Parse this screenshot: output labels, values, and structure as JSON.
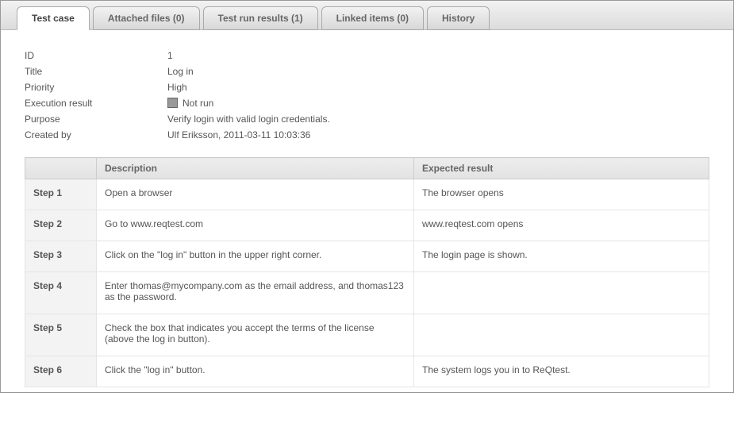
{
  "tabs": [
    {
      "label": "Test case",
      "active": true
    },
    {
      "label": "Attached files (0)",
      "active": false
    },
    {
      "label": "Test run results (1)",
      "active": false
    },
    {
      "label": "Linked items (0)",
      "active": false
    },
    {
      "label": "History",
      "active": false
    }
  ],
  "meta": {
    "id_label": "ID",
    "id_value": "1",
    "title_label": "Title",
    "title_value": "Log in",
    "priority_label": "Priority",
    "priority_value": "High",
    "exec_label": "Execution result",
    "exec_value": "Not run",
    "purpose_label": "Purpose",
    "purpose_value": "Verify login with valid login credentials.",
    "created_label": "Created by",
    "created_value": "Ulf Eriksson, 2011-03-11 10:03:36"
  },
  "table": {
    "headers": {
      "step": "",
      "description": "Description",
      "expected": "Expected result"
    },
    "rows": [
      {
        "step": "Step 1",
        "description": "Open a browser",
        "expected": "The browser opens"
      },
      {
        "step": "Step 2",
        "description": "Go to www.reqtest.com",
        "expected": "www.reqtest.com opens"
      },
      {
        "step": "Step 3",
        "description": "Click on the \"log in\" button in the upper right corner.",
        "expected": "The login page is shown."
      },
      {
        "step": "Step 4",
        "description": "Enter thomas@mycompany.com as the email address, and thomas123 as the password.",
        "expected": ""
      },
      {
        "step": "Step 5",
        "description": "Check the box that indicates you accept the terms of the license (above the log in button).",
        "expected": ""
      },
      {
        "step": "Step 6",
        "description": "Click the \"log in\" button.",
        "expected": "The system logs you in to ReQtest."
      }
    ]
  }
}
